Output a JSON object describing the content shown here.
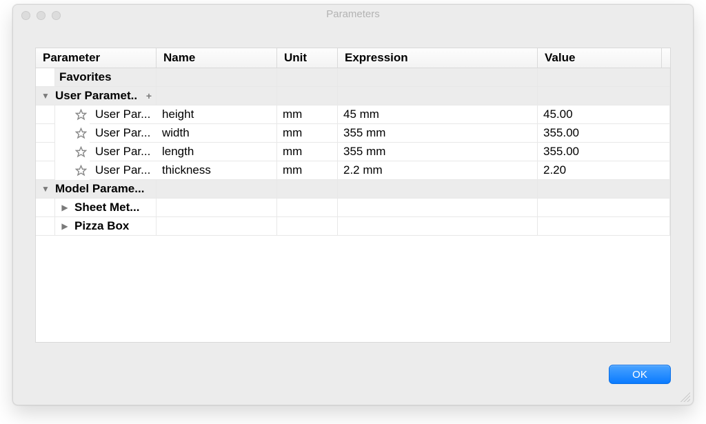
{
  "window": {
    "title": "Parameters"
  },
  "columns": {
    "parameter": "Parameter",
    "name": "Name",
    "unit": "Unit",
    "expression": "Expression",
    "value": "Value"
  },
  "groups": {
    "favorites": {
      "label": "Favorites"
    },
    "user": {
      "label": "User Paramet..",
      "add_icon": "+"
    },
    "model": {
      "label": "Model Parame..."
    }
  },
  "user_params": [
    {
      "param_label": "User Par...",
      "name": "height",
      "unit": "mm",
      "expression": "45 mm",
      "value": "45.00"
    },
    {
      "param_label": "User Par...",
      "name": "width",
      "unit": "mm",
      "expression": "355 mm",
      "value": "355.00"
    },
    {
      "param_label": "User Par...",
      "name": "length",
      "unit": "mm",
      "expression": "355 mm",
      "value": "355.00"
    },
    {
      "param_label": "User Par...",
      "name": "thickness",
      "unit": "mm",
      "expression": "2.2 mm",
      "value": "2.20"
    }
  ],
  "model_subgroups": [
    {
      "label": "Sheet Met..."
    },
    {
      "label": "Pizza Box"
    }
  ],
  "buttons": {
    "ok": "OK"
  }
}
